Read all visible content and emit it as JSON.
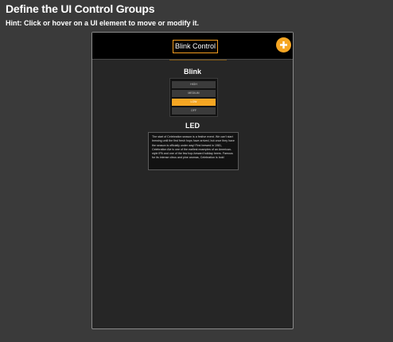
{
  "header": {
    "title": "Define the UI Control Groups",
    "hint": "Hint: Click or hover on a UI element to move or modify it."
  },
  "device": {
    "title": "Blink Control",
    "add_icon": "plus-circle-icon",
    "accent_color": "#f6a623"
  },
  "blink": {
    "label": "Blink",
    "options": [
      "HIGH",
      "MEDIUM",
      "LOW",
      "OFF"
    ],
    "selected": "LOW"
  },
  "led": {
    "label": "LED",
    "text": "The start of Celebration season is a festive event. We can't start brewing until the first fresh hops have arrived, but once they have the season is officially under way! First brewed in 1981, Celebration Ale is one of the earliest examples of an American-style IPA and one of the few hop-forward holiday beers. Famous for its intense citrus and pine aromas, Celebration is bold"
  }
}
